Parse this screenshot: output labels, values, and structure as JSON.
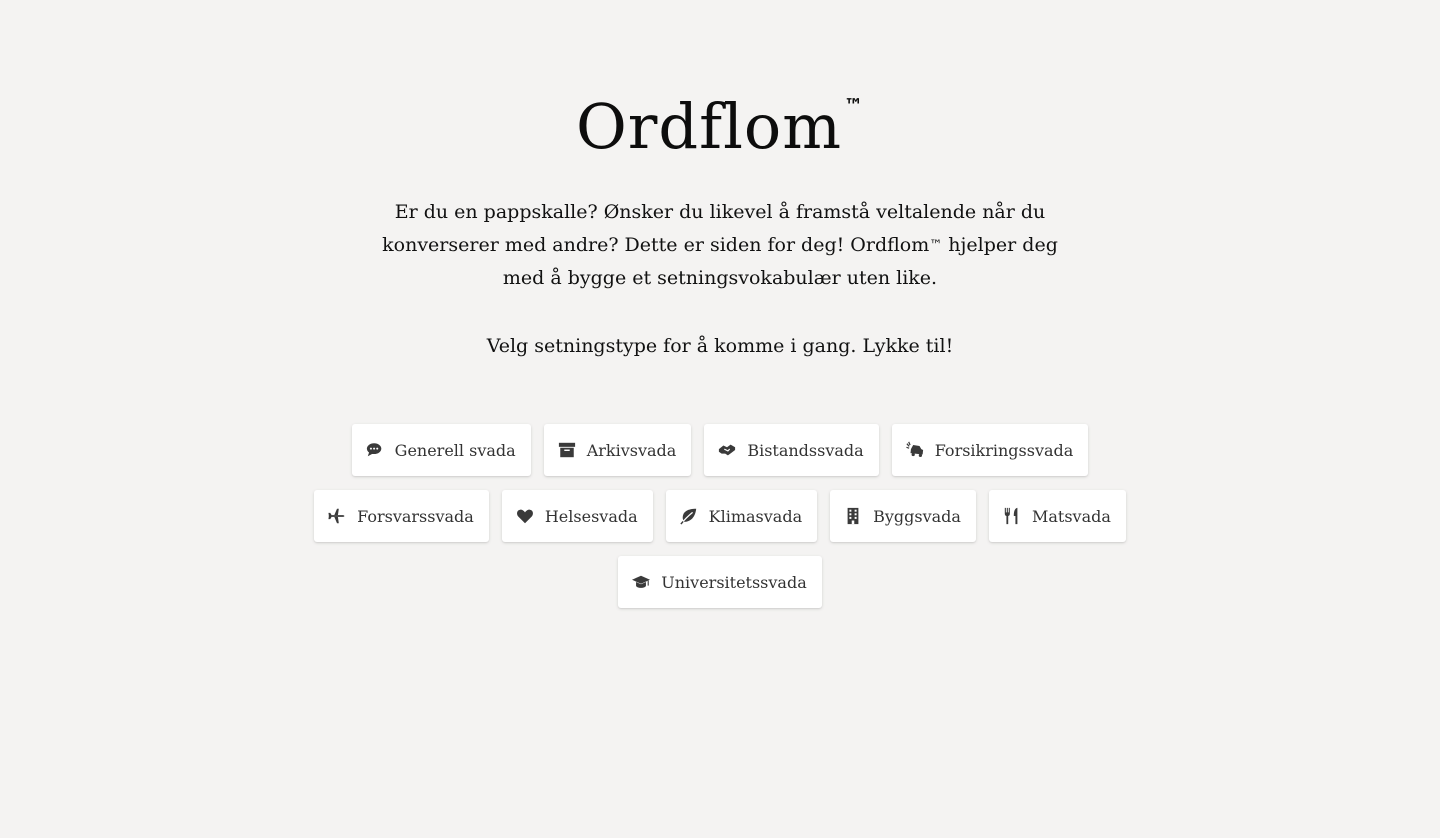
{
  "header": {
    "title": "Ordflom",
    "trademark": "™"
  },
  "intro": {
    "part1": "Er du en pappskalle? Ønsker du likevel å framstå veltalende når du konverserer med andre? Dette er siden for deg! Ordflom",
    "trademark": "™",
    "part2": " hjelper deg med å bygge et setningsvokabulær uten like."
  },
  "cta": "Velg setningstype for å komme i gang. Lykke til!",
  "buttons": [
    {
      "label": "Generell svada",
      "icon": "chat-bubble-icon"
    },
    {
      "label": "Arkivsvada",
      "icon": "archive-box-icon"
    },
    {
      "label": "Bistandssvada",
      "icon": "handshake-icon"
    },
    {
      "label": "Forsikringssvada",
      "icon": "car-crash-icon"
    },
    {
      "label": "Forsvarssvada",
      "icon": "airplane-icon"
    },
    {
      "label": "Helsesvada",
      "icon": "heart-icon"
    },
    {
      "label": "Klimasvada",
      "icon": "leaf-icon"
    },
    {
      "label": "Byggsvada",
      "icon": "building-icon"
    },
    {
      "label": "Matsvada",
      "icon": "fork-knife-icon"
    },
    {
      "label": "Universitetssvada",
      "icon": "graduation-cap-icon"
    }
  ],
  "colors": {
    "background": "#f4f3f2",
    "button_bg": "#ffffff",
    "text": "#111111",
    "icon": "#3a3a3a"
  }
}
